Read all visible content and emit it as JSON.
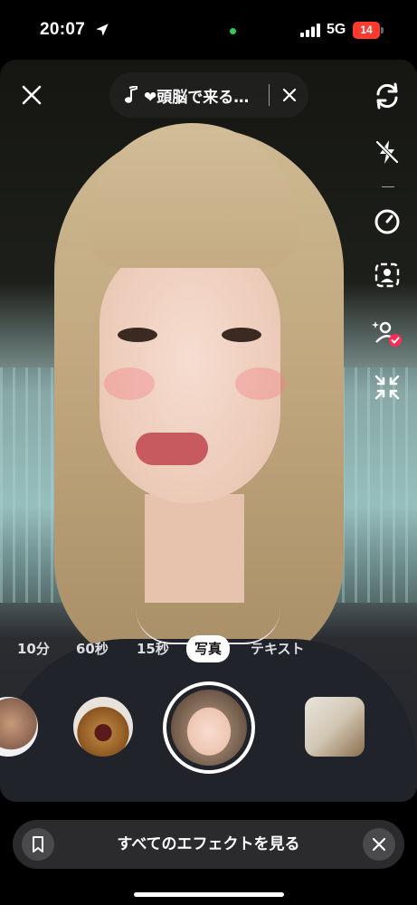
{
  "status_bar": {
    "time": "20:07",
    "network": "5G",
    "battery": "14",
    "icons": [
      "location-arrow-icon",
      "signal-bars-icon",
      "battery-icon"
    ]
  },
  "sound": {
    "title": "❤頭脳で来る…",
    "icon": "music-note-icon"
  },
  "camera_controls": {
    "close_icon": "close-icon",
    "rail": [
      "flip-camera-icon",
      "flash-off-icon",
      "timer-icon",
      "face-frame-icon",
      "beauty-icon",
      "collapse-icon"
    ]
  },
  "modes": {
    "items": [
      "10分",
      "60秒",
      "15秒",
      "写真",
      "テキスト"
    ],
    "selected": "写真"
  },
  "effects": {
    "items": [
      "effect-comedian",
      "effect-dog-face",
      "effect-beauty-face",
      "effect-bear-shirt"
    ],
    "selected": "effect-beauty-face"
  },
  "bottom_bar": {
    "label": "すべてのエフェクトを見る",
    "bookmark_icon": "bookmark-icon",
    "dismiss_icon": "close-icon"
  },
  "colors": {
    "accent_red": "#ff3b30",
    "active_dot": "#34c759",
    "bar_bg": "#2b2b2d"
  }
}
